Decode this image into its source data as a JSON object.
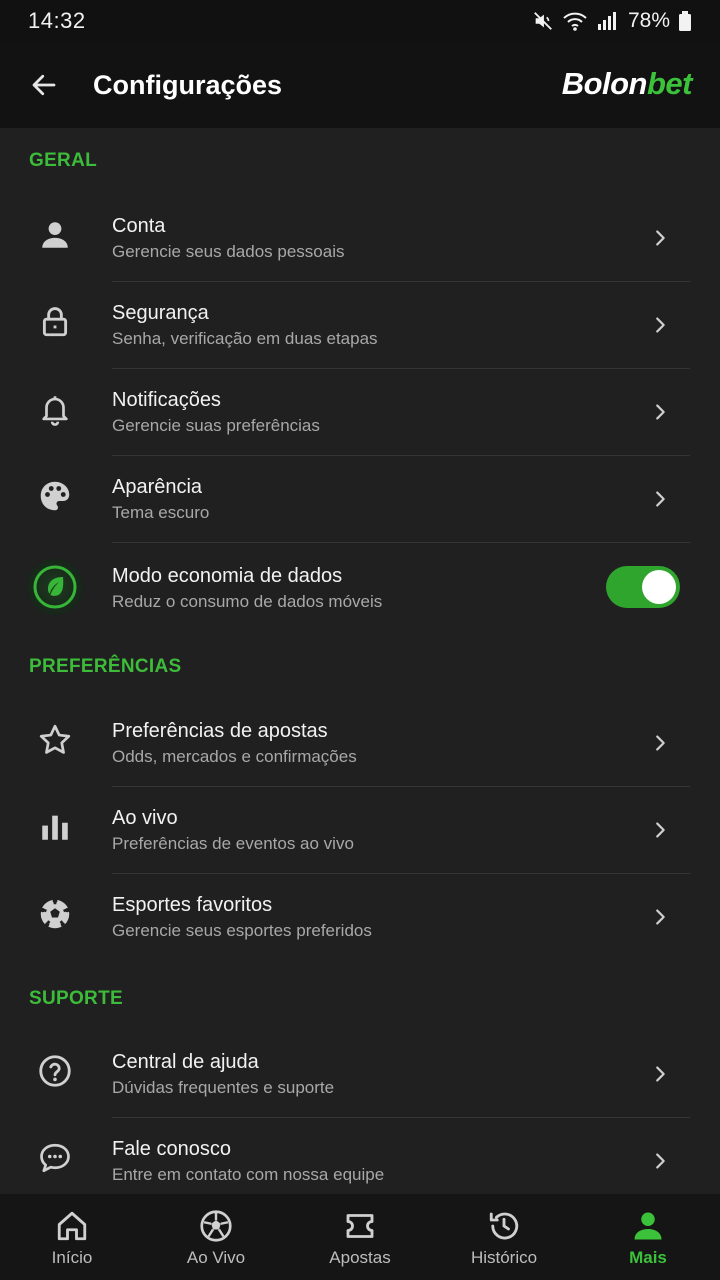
{
  "status_bar": {
    "time": "14:32",
    "battery": "78%"
  },
  "header": {
    "title": "Configurações",
    "brand_part1": "Bolon",
    "brand_part2": "bet"
  },
  "colors": {
    "accent": "#3cc13b",
    "background": "#202020",
    "header": "#121212"
  },
  "sections": [
    {
      "title": "GERAL",
      "items": [
        {
          "icon": "user-icon",
          "title": "Conta",
          "subtitle": "Gerencie seus dados pessoais"
        },
        {
          "icon": "lock-icon",
          "title": "Segurança",
          "subtitle": "Senha, verificação em duas etapas"
        },
        {
          "icon": "bell-icon",
          "title": "Notificações",
          "subtitle": "Gerencie suas preferências"
        },
        {
          "icon": "palette-icon",
          "title": "Aparência",
          "subtitle": "Tema escuro"
        },
        {
          "icon": "leaf-icon",
          "title": "Modo economia de dados",
          "subtitle": "Reduz o consumo de dados móveis",
          "toggle": true
        }
      ]
    },
    {
      "title": "PREFERÊNCIAS",
      "items": [
        {
          "icon": "star-icon",
          "title": "Preferências de apostas",
          "subtitle": "Odds, mercados e confirmações"
        },
        {
          "icon": "bar-chart-icon",
          "title": "Ao vivo",
          "subtitle": "Preferências de eventos ao vivo"
        },
        {
          "icon": "soccer-ball-icon",
          "title": "Esportes favoritos",
          "subtitle": "Gerencie seus esportes preferidos"
        }
      ]
    },
    {
      "title": "SUPORTE",
      "items": [
        {
          "icon": "help-circle-icon",
          "title": "Central de ajuda",
          "subtitle": "Dúvidas frequentes e suporte"
        },
        {
          "icon": "chat-icon",
          "title": "Fale conosco",
          "subtitle": "Entre em contato com nossa equipe"
        }
      ]
    }
  ],
  "bottom_nav": [
    {
      "icon": "home-icon",
      "label": "Início"
    },
    {
      "icon": "soccer-ball-icon",
      "label": "Ao Vivo"
    },
    {
      "icon": "ticket-icon",
      "label": "Apostas"
    },
    {
      "icon": "history-icon",
      "label": "Histórico"
    },
    {
      "icon": "person-icon",
      "label": "Mais",
      "active": true
    }
  ]
}
